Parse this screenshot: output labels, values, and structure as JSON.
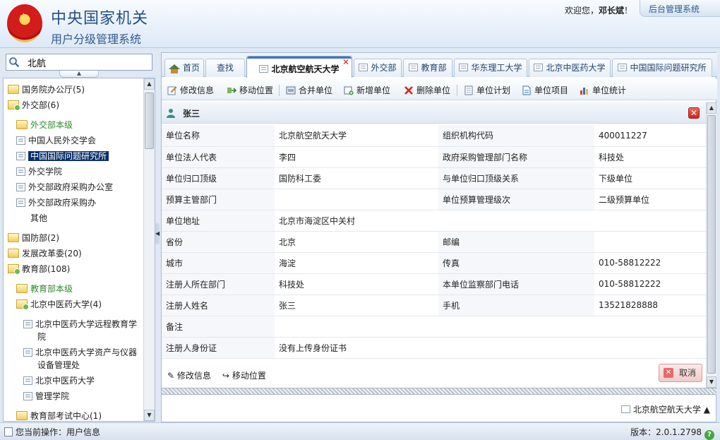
{
  "header": {
    "title": "中央国家机关",
    "subtitle": "用户分级管理系统",
    "welcome_prefix": "欢迎您，",
    "user_name": "邓长斌",
    "welcome_suffix": "！",
    "admin_link": "后台管理系统"
  },
  "search": {
    "value": "北航"
  },
  "tree": {
    "nodes": [
      {
        "label": "国务院办公厅(5)"
      },
      {
        "label": "外交部(6)"
      },
      {
        "label": "外交部本级"
      },
      {
        "label": "中国人民外交学会"
      },
      {
        "label": "中国国际问题研究所"
      },
      {
        "label": "外交学院"
      },
      {
        "label": "外交部政府采购办公室"
      },
      {
        "label": "外交部政府采购办"
      },
      {
        "label": "其他"
      },
      {
        "label": "国防部(2)"
      },
      {
        "label": "发展改革委(20)"
      },
      {
        "label": "教育部(108)"
      },
      {
        "label": "教育部本级"
      },
      {
        "label": "北京中医药大学(4)"
      },
      {
        "label": "北京中医药大学远程教育学"
      },
      {
        "label": "院"
      },
      {
        "label": "北京中医药大学资产与仪器"
      },
      {
        "label": "设备管理处"
      },
      {
        "label": "北京中医药大学"
      },
      {
        "label": "管理学院"
      },
      {
        "label": "教育部考试中心(1)"
      }
    ]
  },
  "tabs": [
    {
      "label": "首页"
    },
    {
      "label": "查找"
    },
    {
      "label": "北京航空航天大学"
    },
    {
      "label": "外交部"
    },
    {
      "label": "教育部"
    },
    {
      "label": "华东理工大学"
    },
    {
      "label": "北京中医药大学"
    },
    {
      "label": "中国国际问题研究所"
    }
  ],
  "toolbar": {
    "edit": "修改信息",
    "move": "移动位置",
    "merge": "合并单位",
    "add": "新增单位",
    "delete": "删除单位",
    "plan": "单位计划",
    "project": "单位项目",
    "stats": "单位统计"
  },
  "form": {
    "title": "张三",
    "rows": [
      {
        "l1": "单位名称",
        "v1": "北京航空航天大学",
        "l2": "组织机构代码",
        "v2": "400011227"
      },
      {
        "l1": "单位法人代表",
        "v1": "李四",
        "l2": "政府采购管理部门名称",
        "v2": "科技处"
      },
      {
        "l1": "单位归口顶级",
        "v1": "国防科工委",
        "l2": "与单位归口顶级关系",
        "v2": "下级单位"
      },
      {
        "l1": "预算主管部门",
        "v1": "",
        "l2": "单位预算管理级次",
        "v2": "二级预算单位"
      },
      {
        "l1": "单位地址",
        "v1": "北京市海淀区中关村"
      },
      {
        "l1": "省份",
        "v1": "北京",
        "l2": "邮编",
        "v2": ""
      },
      {
        "l1": "城市",
        "v1": "海淀",
        "l2": "传真",
        "v2": "010-58812222"
      },
      {
        "l1": "注册人所在部门",
        "v1": "科技处",
        "l2": "本单位监察部门电话",
        "v2": "010-58812222"
      },
      {
        "l1": "注册人姓名",
        "v1": "张三",
        "l2": "手机",
        "v2": "13521828888"
      },
      {
        "l1": "备注",
        "v1": ""
      },
      {
        "l1": "注册人身份证",
        "v1": "没有上传身份证书"
      }
    ],
    "foot_edit": "修改信息",
    "foot_move": "移动位置",
    "cancel": "取消"
  },
  "bottom_crumb": "北京航空航天大学",
  "status": {
    "operation": "您当前操作：用户信息",
    "version": "版本：2.0.1.2798"
  }
}
